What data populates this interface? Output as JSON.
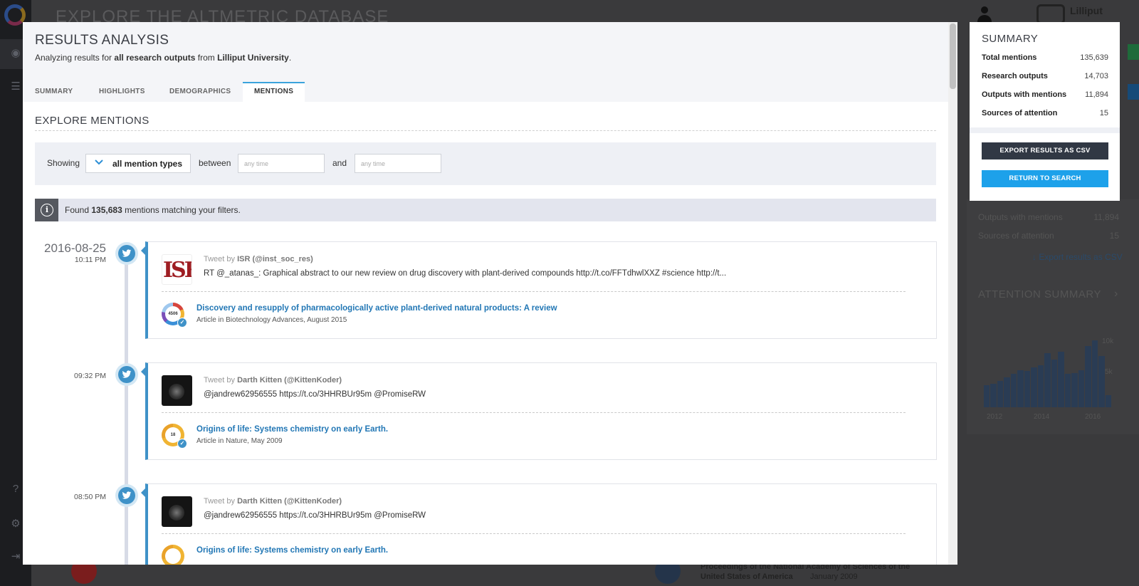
{
  "background": {
    "page_title": "EXPLORE THE ALTMETRIC DATABASE",
    "brand": "Lilliput",
    "right_panel": {
      "rows": [
        {
          "label": "Outputs with mentions",
          "value": "11,894"
        },
        {
          "label": "Sources of attention",
          "value": "15"
        }
      ],
      "export_link": "Export results as CSV",
      "attention_title": "ATTENTION SUMMARY",
      "chart_data": {
        "type": "bar",
        "values": [
          3,
          3.2,
          3.6,
          4.1,
          4.6,
          5.1,
          5.0,
          5.5,
          5.8,
          7.5,
          6.6,
          7.6,
          4.6,
          4.7,
          5.1,
          8.4,
          9.2,
          7.1,
          1.7
        ],
        "ylim": [
          0,
          10
        ],
        "yticks": [
          "10k",
          "5k",
          "0"
        ],
        "xticks": [
          "2012",
          "2014",
          "2016"
        ]
      }
    },
    "bottom_texts": [
      "Proceedings of the National Academy of Sciences of the",
      "United States of America",
      "January 2009"
    ]
  },
  "modal": {
    "title": "RESULTS ANALYSIS",
    "subtitle": {
      "prefix": "Analyzing results for",
      "scope": "all research outputs",
      "mid": "from",
      "institution": "Lilliput University",
      "suffix": "."
    },
    "tabs": [
      {
        "label": "SUMMARY"
      },
      {
        "label": "HIGHLIGHTS"
      },
      {
        "label": "DEMOGRAPHICS"
      },
      {
        "label": "MENTIONS"
      }
    ],
    "active_tab": "MENTIONS",
    "section_title": "EXPLORE MENTIONS",
    "filters": {
      "showing_label": "Showing",
      "type_value": "all mention types",
      "between_label": "between",
      "from_placeholder": "any time",
      "and_label": "and",
      "to_placeholder": "any time"
    },
    "info": {
      "prefix": "Found",
      "count": "135,683",
      "suffix": "mentions matching your filters."
    },
    "mentions": [
      {
        "date": "2016-08-25",
        "time": "10:11 PM",
        "tweet_by_prefix": "Tweet by",
        "author": "ISR (@inst_soc_res)",
        "avatar": "ISR",
        "text": "RT @_atanas_: Graphical abstract to our new review on drug discovery with plant-derived compounds http://t.co/FFTdhwlXXZ #science http://t...",
        "score": "4506",
        "article_title": "Discovery and resupply of pharmacologically active plant-derived natural products: A review",
        "article_meta": "Article in Biotechnology Advances, August 2015"
      },
      {
        "date": "",
        "time": "09:32 PM",
        "tweet_by_prefix": "Tweet by",
        "author": "Darth Kitten (@KittenKoder)",
        "text": "@jandrew62956555 https://t.co/3HHRBUr95m @PromiseRW",
        "score": "18",
        "article_title": "Origins of life: Systems chemistry on early Earth.",
        "article_meta": "Article in Nature, May 2009"
      },
      {
        "date": "",
        "time": "08:50 PM",
        "tweet_by_prefix": "Tweet by",
        "author": "Darth Kitten (@KittenKoder)",
        "text": "@jandrew62956555 https://t.co/3HHRBUr95m @PromiseRW",
        "score": "",
        "article_title": "Origins of life: Systems chemistry on early Earth.",
        "article_meta": ""
      }
    ]
  },
  "summary": {
    "title": "SUMMARY",
    "rows": [
      {
        "label": "Total mentions",
        "value": "135,639"
      },
      {
        "label": "Research outputs",
        "value": "14,703"
      },
      {
        "label": "Outputs with mentions",
        "value": "11,894"
      },
      {
        "label": "Sources of attention",
        "value": "15"
      }
    ],
    "export_button": "EXPORT RESULTS AS CSV",
    "return_button": "RETURN TO SEARCH"
  },
  "colors": {
    "accent_blue": "#3f92c8",
    "tab_active_border": "#3aa3dc",
    "button_dark": "#313844",
    "button_blue": "#1da1ea",
    "isr_red": "#9e1d22"
  },
  "icons": [
    "twitter-icon",
    "info-icon",
    "chevron-down-icon",
    "check-icon",
    "user-icon",
    "compass-icon",
    "list-icon",
    "help-icon",
    "gear-icon",
    "logout-icon"
  ]
}
